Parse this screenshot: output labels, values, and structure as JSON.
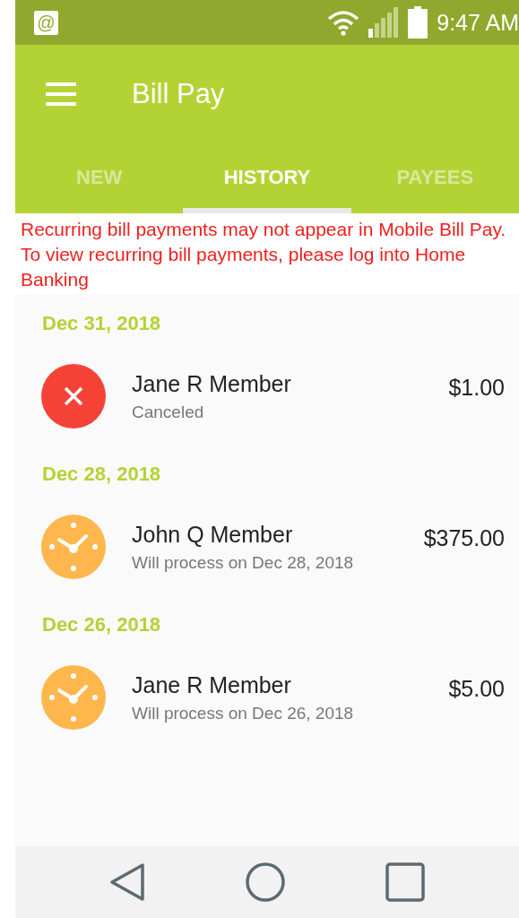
{
  "status_bar": {
    "app_icon": "@",
    "time": "9:47 AM"
  },
  "app_bar": {
    "title": "Bill Pay"
  },
  "tabs": [
    {
      "label": "NEW",
      "selected": false
    },
    {
      "label": "HISTORY",
      "selected": true
    },
    {
      "label": "PAYEES",
      "selected": false
    }
  ],
  "notice": "Recurring bill payments may not appear in Mobile Bill Pay. To view recurring bill payments, please log into Home Banking",
  "history": [
    {
      "date": "Dec 31, 2018",
      "payments": [
        {
          "kind": "canceled",
          "payee": "Jane R Member",
          "amount": "$1.00",
          "status": "Canceled"
        }
      ]
    },
    {
      "date": "Dec 28, 2018",
      "payments": [
        {
          "kind": "pending",
          "payee": "John Q Member",
          "amount": "$375.00",
          "status": "Will process on Dec 28, 2018"
        }
      ]
    },
    {
      "date": "Dec 26, 2018",
      "payments": [
        {
          "kind": "pending",
          "payee": "Jane R Member",
          "amount": "$5.00",
          "status": "Will process on Dec 26, 2018"
        }
      ]
    }
  ]
}
